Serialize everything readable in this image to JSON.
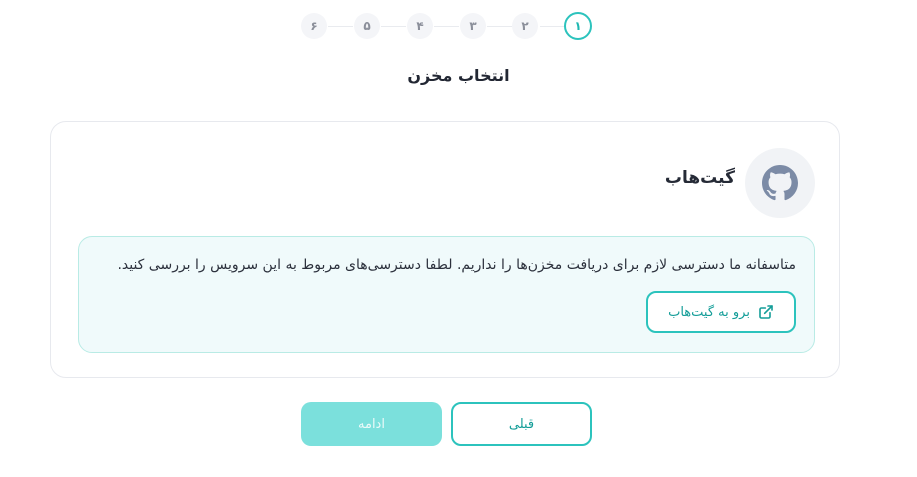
{
  "stepper": {
    "steps": [
      "۱",
      "۲",
      "۳",
      "۴",
      "۵",
      "۶"
    ],
    "active_step": "۱"
  },
  "title": "انتخاب مخزن",
  "provider": {
    "name": "گیت‌هاب",
    "icon": "github-icon"
  },
  "notice": {
    "message": "متاسفانه ما دسترسی لازم برای دریافت مخزن‌ها را نداریم. لطفا دسترسی‌های مربوط به این سرویس را بررسی کنید.",
    "button_label": "برو به گیت‌هاب",
    "button_icon": "external-link-icon"
  },
  "actions": {
    "prev_label": "قبلی",
    "next_label": "ادامه"
  },
  "colors": {
    "accent": "#2cc3bd",
    "accent_text": "#139d98",
    "notice_bg": "#f0fafb",
    "notice_border": "#b9ebe5",
    "disabled_button": "#7be0dc"
  }
}
